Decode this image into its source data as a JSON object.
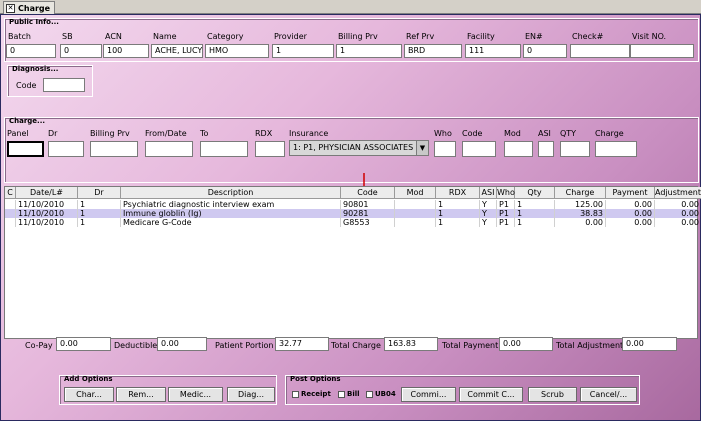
{
  "tab": {
    "title": "Charge",
    "close_glyph": "✕"
  },
  "public_info": {
    "title": "Public Info...",
    "fields": [
      {
        "label": "Batch",
        "value": "0"
      },
      {
        "label": "SB",
        "value": "0"
      },
      {
        "label": "ACN",
        "value": "100"
      },
      {
        "label": "Name",
        "value": "ACHE, LUCY"
      },
      {
        "label": "Category",
        "value": "HMO"
      },
      {
        "label": "Provider",
        "value": "1"
      },
      {
        "label": "Billing Prv",
        "value": "1"
      },
      {
        "label": "Ref Prv",
        "value": "BRD"
      },
      {
        "label": "Facility",
        "value": "111"
      },
      {
        "label": "EN#",
        "value": "0"
      },
      {
        "label": "Check#",
        "value": ""
      },
      {
        "label": "Visit NO.",
        "value": ""
      }
    ]
  },
  "diagnosis": {
    "title": "Diagnosis...",
    "code_label": "Code",
    "code_value": ""
  },
  "charge_entry": {
    "title": "Charge...",
    "fields": [
      {
        "label": "Panel",
        "value": ""
      },
      {
        "label": "Dr",
        "value": ""
      },
      {
        "label": "Billing Prv",
        "value": ""
      },
      {
        "label": "From/Date",
        "value": ""
      },
      {
        "label": "To",
        "value": ""
      },
      {
        "label": "RDX",
        "value": ""
      },
      {
        "label": "Insurance",
        "value": "1: P1, PHYSICIAN ASSOCIATES"
      },
      {
        "label": "Who",
        "value": ""
      },
      {
        "label": "Code",
        "value": ""
      },
      {
        "label": "Mod",
        "value": ""
      },
      {
        "label": "ASI",
        "value": ""
      },
      {
        "label": "QTY",
        "value": ""
      },
      {
        "label": "Charge",
        "value": ""
      }
    ]
  },
  "grid": {
    "columns": [
      "C",
      "Date/L#",
      "Dr",
      "Description",
      "Code",
      "Mod",
      "RDX",
      "ASI",
      "Who",
      "Qty",
      "Charge",
      "Payment",
      "Adjustment"
    ],
    "rows": [
      {
        "c": "",
        "date": "11/10/2010",
        "dr": "1",
        "description": "Psychiatric diagnostic interview exam",
        "code": "90801",
        "mod": "",
        "rdx": "1",
        "asi": "Y",
        "who": "P1",
        "qty": "1",
        "charge": "125.00",
        "payment": "0.00",
        "adjustment": "0.00",
        "selected": false
      },
      {
        "c": "",
        "date": "11/10/2010",
        "dr": "1",
        "description": "Immune globlin (Ig)",
        "code": "90281",
        "mod": "",
        "rdx": "1",
        "asi": "Y",
        "who": "P1",
        "qty": "1",
        "charge": "38.83",
        "payment": "0.00",
        "adjustment": "0.00",
        "selected": true
      },
      {
        "c": "",
        "date": "11/10/2010",
        "dr": "1",
        "description": "Medicare G-Code",
        "code": "G8553",
        "mod": "",
        "rdx": "1",
        "asi": "Y",
        "who": "P1",
        "qty": "1",
        "charge": "0.00",
        "payment": "0.00",
        "adjustment": "0.00",
        "selected": false
      }
    ]
  },
  "totals": [
    {
      "label": "Co-Pay",
      "value": "0.00"
    },
    {
      "label": "Deductible",
      "value": "0.00"
    },
    {
      "label": "Patient Portion",
      "value": "32.77"
    },
    {
      "label": "Total Charge",
      "value": "163.83"
    },
    {
      "label": "Total Payment",
      "value": "0.00"
    },
    {
      "label": "Total Adjustment",
      "value": "0.00"
    }
  ],
  "add_options": {
    "title": "Add Options",
    "buttons": [
      "Char...",
      "Rem...",
      "Medic...",
      "Diag..."
    ]
  },
  "post_options": {
    "title": "Post Options",
    "checkboxes": [
      "Receipt",
      "Bill",
      "UB04"
    ],
    "buttons": [
      "Commi...",
      "Commit C...",
      "Scrub",
      "Cancel/..."
    ]
  },
  "colors": {
    "selected_row": "#cfc9f0",
    "arrow": "#d00000"
  }
}
